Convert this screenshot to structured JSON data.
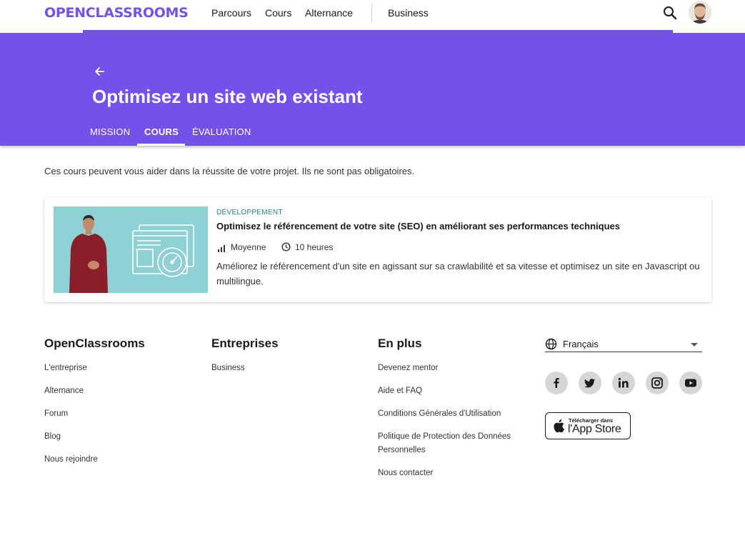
{
  "header": {
    "logo": "OPENCLASSROOMS",
    "nav": [
      "Parcours",
      "Cours",
      "Alternance",
      "Business"
    ]
  },
  "hero": {
    "title": "Optimisez un site web existant",
    "tabs": [
      {
        "label": "MISSION",
        "active": false
      },
      {
        "label": "COURS",
        "active": true
      },
      {
        "label": "ÉVALUATION",
        "active": false
      }
    ]
  },
  "intro": "Ces cours peuvent vous aider dans la réussite de votre projet. Ils ne sont pas obligatoires.",
  "course": {
    "category": "DÉVELOPPEMENT",
    "title": "Optimisez le référencement de votre site (SEO) en améliorant ses performances techniques",
    "level": "Moyenne",
    "duration": "10 heures",
    "description": "Améliorez le référencement d'un site en agissant sur sa crawlabilité et sa vitesse et optimisez un site en Javascript ou multilingue."
  },
  "footer": {
    "columns": [
      {
        "heading": "OpenClassrooms",
        "links": [
          "L'entreprise",
          "Alternance",
          "Forum",
          "Blog",
          "Nous rejoindre"
        ]
      },
      {
        "heading": "Entreprises",
        "links": [
          "Business"
        ]
      },
      {
        "heading": "En plus",
        "links": [
          "Devenez mentor",
          "Aide et FAQ",
          "Conditions Générales d'Utilisation",
          "Politique de Protection des Données Personnelles",
          "Nous contacter"
        ]
      }
    ],
    "language": "Français",
    "social_icons": [
      "facebook-icon",
      "twitter-icon",
      "linkedin-icon",
      "instagram-icon",
      "youtube-icon"
    ],
    "appstore": {
      "small": "Télécharger dans",
      "big": "l'App Store"
    }
  },
  "colors": {
    "brand": "#7451eb",
    "category": "#23818a",
    "thumb_bg": "#8fd0d4"
  }
}
